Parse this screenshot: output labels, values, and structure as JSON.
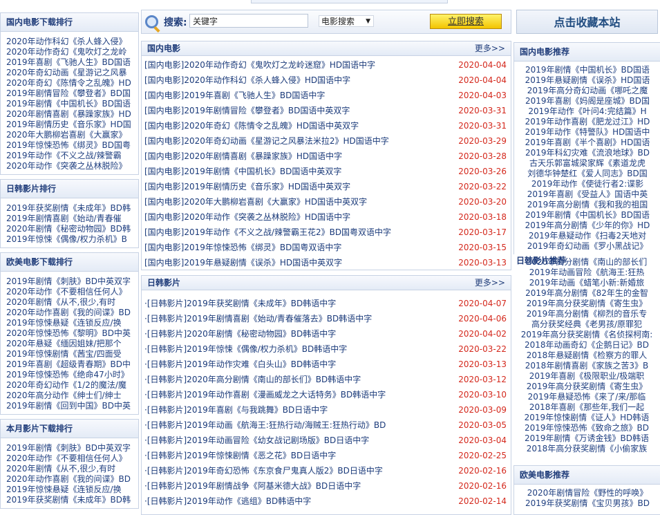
{
  "search": {
    "label": "搜索:",
    "keyword": "关键字",
    "type": "电影搜索",
    "button": "立即搜索"
  },
  "favorite": "点击收藏本站",
  "left_boxes": [
    {
      "title": "国内电影下载排行",
      "items": [
        "2020年动作科幻《杀人蜂入侵》",
        "2020年动作奇幻《鬼吹灯之龙岭",
        "2019年喜剧《飞驰人生》BD国语",
        "2020年奇幻动画《星游记之风暴",
        "2020年奇幻《陈情令之乱魄》HD",
        "2019年剧情冒险《攀登者》BD国",
        "2019年剧情《中国机长》BD国语",
        "2020年剧情喜剧《暴躁家族》HD",
        "2019年剧情历史《音乐家》HD国",
        "2020年大鹏柳岩喜剧《大赢家》",
        "2019年惊悚恐怖《绑灵》BD国粤",
        "2019年动作《不义之战/辣警霸",
        "2020年动作《突袭之丛林脱险》"
      ]
    },
    {
      "title": "日韩影片排行",
      "items": [
        "2019年获奖剧情《未成年》BD韩",
        "2019年剧情喜剧《始动/青春催",
        "2020年剧情《秘密动物园》BD韩",
        "2019年惊悚《偶像/权力杀机》B"
      ]
    },
    {
      "title": "欧美电影下载排行",
      "items": [
        "2019年剧情《刺肤》BD中英双字",
        "2020年动作《不要相信任何人》",
        "2020年剧情《从不,很少,有时",
        "2020年动作喜剧《我的间谍》BD",
        "2019年惊悚悬疑《连锁反应/换",
        "2020年惊悚恐怖《黎明》BD中英",
        "2020年悬疑《缅因姐妹/把那个",
        "2019年惊悚剧情《茜宝/四面受",
        "2019年喜剧《超级青春期》BD中",
        "2019年惊悚恐怖《绝命47小时》",
        "2020年奇幻动作《1/2的魔法/魔",
        "2020年高分动作《绅士们/绅士",
        "2019年剧情《回到中国》BD中英"
      ]
    },
    {
      "title": "本月影片下载排行",
      "items": [
        "2019年剧情《刺肤》BD中英双字",
        "2020年动作《不要相信任何人》",
        "2020年剧情《从不,很少,有时",
        "2020年动作喜剧《我的间谍》BD",
        "2019年惊悚悬疑《连锁反应/换",
        "2019年获奖剧情《未成年》BD韩"
      ]
    }
  ],
  "domestic": {
    "title": "国内电影",
    "more": "更多>>",
    "items": [
      {
        "t": "[国内电影]2020年动作奇幻《鬼吹灯之龙岭迷窟》HD国语中字",
        "d": "2020-04-04"
      },
      {
        "t": "[国内电影]2020年动作科幻《杀人蜂入侵》HD国语中字",
        "d": "2020-04-04"
      },
      {
        "t": "[国内电影]2019年喜剧《飞驰人生》BD国语中字",
        "d": "2020-04-03"
      },
      {
        "t": "[国内电影]2019年剧情冒险《攀登者》BD国语中英双字",
        "d": "2020-03-31"
      },
      {
        "t": "[国内电影]2020年奇幻《陈情令之乱魄》HD国语中英双字",
        "d": "2020-03-31"
      },
      {
        "t": "[国内电影]2020年奇幻动画《星游记之风暴法米拉2》HD国语中字",
        "d": "2020-03-29"
      },
      {
        "t": "[国内电影]2020年剧情喜剧《暴躁家族》HD国语中字",
        "d": "2020-03-28"
      },
      {
        "t": "[国内电影]2019年剧情《中国机长》BD国语中英双字",
        "d": "2020-03-26"
      },
      {
        "t": "[国内电影]2019年剧情历史《音乐家》HD国语中英双字",
        "d": "2020-03-22"
      },
      {
        "t": "[国内电影]2020年大鹏柳岩喜剧《大赢家》HD国语中英双字",
        "d": "2020-03-20"
      },
      {
        "t": "[国内电影]2020年动作《突袭之丛林脱险》HD国语中字",
        "d": "2020-03-18"
      },
      {
        "t": "[国内电影]2019年动作《不义之战/辣警霸王花2》BD国粤双语中字",
        "d": "2020-03-17"
      },
      {
        "t": "[国内电影]2019年惊悚恐怖《绑灵》BD国粤双语中字",
        "d": "2020-03-15"
      },
      {
        "t": "[国内电影]2019年悬疑剧情《误杀》HD国语中英双字",
        "d": "2020-03-13"
      }
    ]
  },
  "jpkr": {
    "title": "日韩影片",
    "more": "更多>>",
    "items": [
      {
        "t": "·[日韩影片]2019年获奖剧情《未成年》BD韩语中字",
        "d": "2020-04-07"
      },
      {
        "t": "·[日韩影片]2019年剧情喜剧《始动/青春催落去》BD韩语中字",
        "d": "2020-04-06"
      },
      {
        "t": "·[日韩影片]2020年剧情《秘密动物园》BD韩语中字",
        "d": "2020-04-02"
      },
      {
        "t": "·[日韩影片]2019年惊悚《偶像/权力杀机》BD韩语中字",
        "d": "2020-03-22"
      },
      {
        "t": "·[日韩影片]2019年动作灾难《白头山》BD韩语中字",
        "d": "2020-03-13"
      },
      {
        "t": "·[日韩影片]2020年高分剧情《南山的部长们》BD韩语中字",
        "d": "2020-03-12"
      },
      {
        "t": "·[日韩影片]2019年动作喜剧《漫画威龙之大话特务》BD韩语中字",
        "d": "2020-03-10"
      },
      {
        "t": "·[日韩影片]2019年喜剧《与我跳舞》BD日语中字",
        "d": "2020-03-09"
      },
      {
        "t": "·[日韩影片]2019年动画《航海王:狂热行动/海贼王:狂热行动》BD",
        "d": "2020-03-05"
      },
      {
        "t": "·[日韩影片]2019年动画冒险《幼女战记剧场版》BD日语中字",
        "d": "2020-03-04"
      },
      {
        "t": "·[日韩影片]2019年惊悚剧情《恶之花》BD日语中字",
        "d": "2020-02-25"
      },
      {
        "t": "·[日韩影片]2019年奇幻恐怖《东京食尸鬼真人版2》BD日语中字",
        "d": "2020-02-16"
      },
      {
        "t": "·[日韩影片]2019年剧情战争《阿基米德大战》BD日语中字",
        "d": "2020-02-16"
      },
      {
        "t": "·[日韩影片]2019年动作《逃组》BD韩语中字",
        "d": "2020-02-14"
      }
    ]
  },
  "right_domestic": {
    "title": "国内电影推荐",
    "items": [
      "2019年剧情《中国机长》BD国语",
      "2019年悬疑剧情《误杀》HD国语",
      "2019年高分奇幻动画《哪吒之魔",
      "2019年喜剧《妈阁是座城》BD国",
      "2019年动作《叶问4:完结篇》H",
      "2019年动作喜剧《肥龙过江》HD",
      "2019年动作《特警队》HD国语中",
      "2019年喜剧《半个喜剧》HD国语",
      "2019年科幻灾难《流浪地球》BD",
      "古天乐郭富城梁家辉《素道龙虎",
      "刘德华钟楚红《爱人同志》BD国",
      "2019年动作《使徒行者2:谍影",
      "2019年喜剧《受益人》国语中英",
      "2019年高分剧情《我和我的祖国",
      "2019年剧情《中国机长》BD国语",
      "2019年高分剧情《少年的你》HD",
      "2019年悬疑动作《扫毒2天地对",
      "2019年奇幻动画《罗小黑战记》"
    ]
  },
  "right_jpkr": {
    "title": "日韩影片推荐",
    "items": [
      "2020年高分剧情《南山的部长们",
      "2019年动画冒险《航海王:狂热",
      "2019年动画《蜡笔小新:新婚旅",
      "2019年高分剧情《82年生的金智",
      "2019年高分获奖剧情《寄生虫》",
      "2019年高分剧情《柳烈的音乐专",
      "高分获奖经典《老男孩/原罪犯",
      "2019年高分获奖剧情《名侦探柯南:",
      "2018年动画奇幻《企鹅日记》BD",
      "2018年悬疑剧情《检察方的罪人",
      "2018年剧情喜剧《家族之苦3》B",
      "2019年喜剧《极限职业/极端职",
      "2019年高分获奖剧情《寄生虫》",
      "2019年悬疑恐怖《来了/来/那临",
      "2018年喜剧《那些年,我们一起",
      "2019年惊悚剧情《证人》HD韩语",
      "2019年惊悚恐怖《致命之旅》BD",
      "2019年剧情《万诱金钱》BD韩语",
      "2018年高分获奖剧情《小偷家族"
    ]
  },
  "right_west": {
    "title": "欧美电影推荐",
    "items": [
      "2020年剧情冒险《野性的呼唤》",
      "2019年获奖剧情《宝贝男孩》BD"
    ]
  }
}
